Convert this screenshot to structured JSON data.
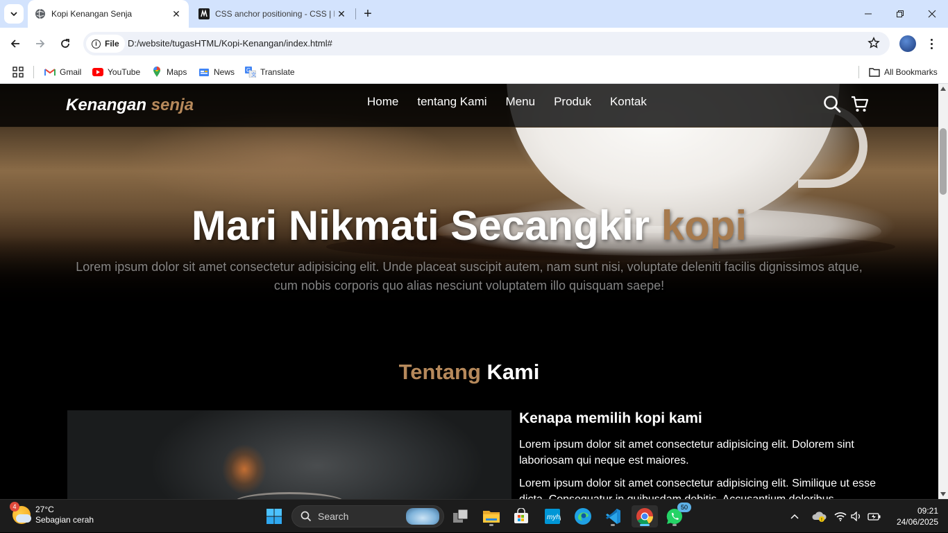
{
  "browser": {
    "tabs": [
      {
        "title": "Kopi Kenangan Senja",
        "active": true
      },
      {
        "title": "CSS anchor positioning - CSS | MDN",
        "active": false
      }
    ],
    "address": {
      "scheme_label": "File",
      "url": "D:/website/tugasHTML/Kopi-Kenangan/index.html#"
    },
    "bookmarks": [
      {
        "label": "Gmail",
        "icon": "gmail-icon"
      },
      {
        "label": "YouTube",
        "icon": "youtube-icon"
      },
      {
        "label": "Maps",
        "icon": "maps-icon"
      },
      {
        "label": "News",
        "icon": "news-icon"
      },
      {
        "label": "Translate",
        "icon": "translate-icon"
      }
    ],
    "all_bookmarks_label": "All Bookmarks"
  },
  "site": {
    "logo": {
      "main": "Kenangan ",
      "accent": "senja"
    },
    "nav": [
      "Home",
      "tentang Kami",
      "Menu",
      "Produk",
      "Kontak"
    ],
    "hero": {
      "title_main": "Mari Nikmati Secangkir ",
      "title_accent": "kopi",
      "text": "Lorem ipsum dolor sit amet consectetur adipisicing elit. Unde placeat suscipit autem, nam sunt nisi, voluptate deleniti facilis dignissimos atque, cum nobis corporis quo alias nesciunt voluptatem illo quisquam saepe!"
    },
    "about": {
      "title_accent": "Tentang",
      "title_main": " Kami",
      "heading": "Kenapa memilih kopi kami",
      "paragraphs": [
        "Lorem ipsum dolor sit amet consectetur adipisicing elit. Dolorem sint laboriosam qui neque est maiores.",
        "Lorem ipsum dolor sit amet consectetur adipisicing elit. Similique ut esse dicta. Consequatur in quibusdam debitis. Accusantium doloribus"
      ]
    }
  },
  "taskbar": {
    "weather": {
      "temp": "27°C",
      "desc": "Sebagian cerah",
      "badge": "4"
    },
    "search_label": "Search",
    "whatsapp_badge": "50",
    "time": "09:21",
    "date": "24/06/2025"
  },
  "colors": {
    "accent": "#b6895b",
    "tab_strip": "#d3e3fd",
    "taskbar": "#1c1c1c"
  }
}
